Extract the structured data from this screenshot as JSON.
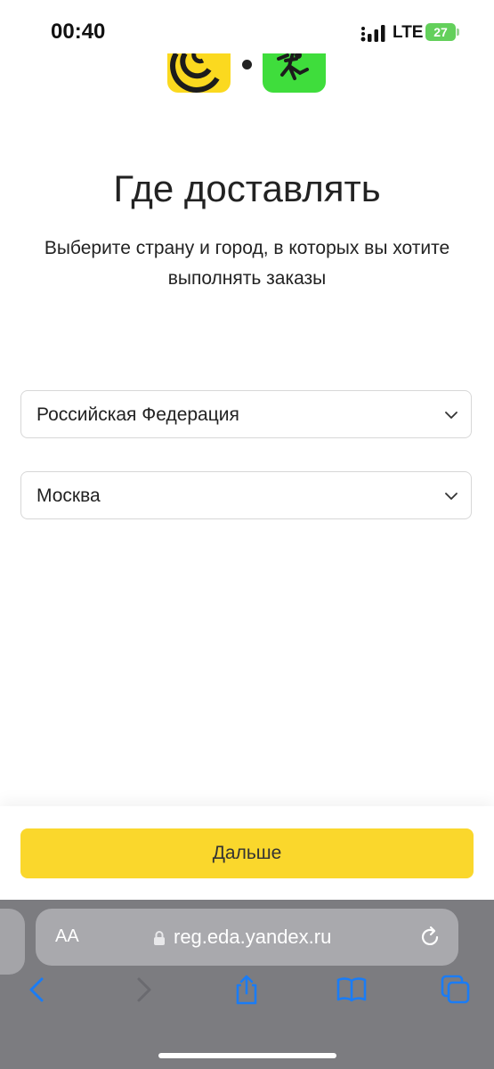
{
  "status_bar": {
    "time": "00:40",
    "network": "LTE",
    "battery": "27",
    "icons": [
      "signal-icon",
      "battery-icon"
    ]
  },
  "page": {
    "title": "Где доставлять",
    "subtitle": "Выберите страну и город, в которых вы хотите выполнять заказы"
  },
  "form": {
    "country": {
      "value": "Российская Федерация"
    },
    "city": {
      "value": "Москва"
    }
  },
  "footer": {
    "next_label": "Дальше"
  },
  "browser": {
    "text_size_label": "AA",
    "url": "reg.eda.yandex.ru",
    "icons": [
      "back-icon",
      "forward-icon",
      "share-icon",
      "bookmarks-icon",
      "tabs-icon",
      "lock-icon",
      "reload-icon"
    ]
  },
  "colors": {
    "accent_yellow": "#fad72c",
    "logo_green": "#3fdd3c",
    "link_blue": "#1a7cf5",
    "browser_bar": "#7c7c80"
  }
}
